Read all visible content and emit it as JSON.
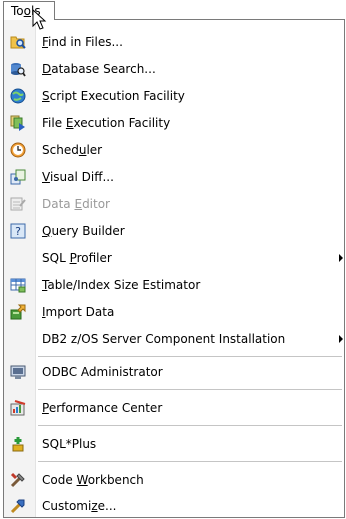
{
  "menubar": {
    "tools_label": {
      "pre": "To",
      "mn": "o",
      "post": "ls"
    }
  },
  "menu": {
    "items": [
      {
        "pre": "",
        "mn": "F",
        "post": "ind in Files...",
        "icon": "find-in-files-icon"
      },
      {
        "pre": "",
        "mn": "D",
        "post": "atabase Search...",
        "icon": "database-search-icon"
      },
      {
        "pre": "",
        "mn": "S",
        "post": "cript Execution Facility",
        "icon": "script-execution-icon"
      },
      {
        "pre": "File ",
        "mn": "E",
        "post": "xecution Facility",
        "icon": "file-execution-icon"
      },
      {
        "pre": "Sched",
        "mn": "u",
        "post": "ler",
        "icon": "scheduler-icon"
      },
      {
        "pre": "",
        "mn": "V",
        "post": "isual Diff...",
        "icon": "visual-diff-icon"
      },
      {
        "pre": "Data ",
        "mn": "E",
        "post": "ditor",
        "icon": "data-editor-icon",
        "disabled": true
      },
      {
        "pre": "",
        "mn": "Q",
        "post": "uery Builder",
        "icon": "query-builder-icon"
      },
      {
        "pre": "SQL ",
        "mn": "P",
        "post": "rofiler",
        "submenu": true
      },
      {
        "pre": "",
        "mn": "T",
        "post": "able/Index Size Estimator",
        "icon": "table-index-estimator-icon"
      },
      {
        "pre": "",
        "mn": "I",
        "post": "mport Data",
        "icon": "import-data-icon"
      },
      {
        "pre": "DB2 z/OS Server Component Installation",
        "mn": "",
        "post": "",
        "submenu": true
      },
      {
        "pre": "ODBC Administrator",
        "mn": "",
        "post": "",
        "icon": "odbc-administrator-icon"
      },
      {
        "pre": "",
        "mn": "P",
        "post": "erformance Center",
        "icon": "performance-center-icon"
      },
      {
        "pre": "SQL*Plus",
        "mn": "",
        "post": "",
        "icon": "sqlplus-icon"
      },
      {
        "pre": "Code ",
        "mn": "W",
        "post": "orkbench",
        "icon": "code-workbench-icon"
      },
      {
        "pre": "Customi",
        "mn": "z",
        "post": "e...",
        "icon": "customize-icon"
      }
    ]
  },
  "colors": {
    "accent": "#1e6fc0",
    "gutter": "#f3f3f3",
    "disabled_text": "#9a9a9a"
  }
}
